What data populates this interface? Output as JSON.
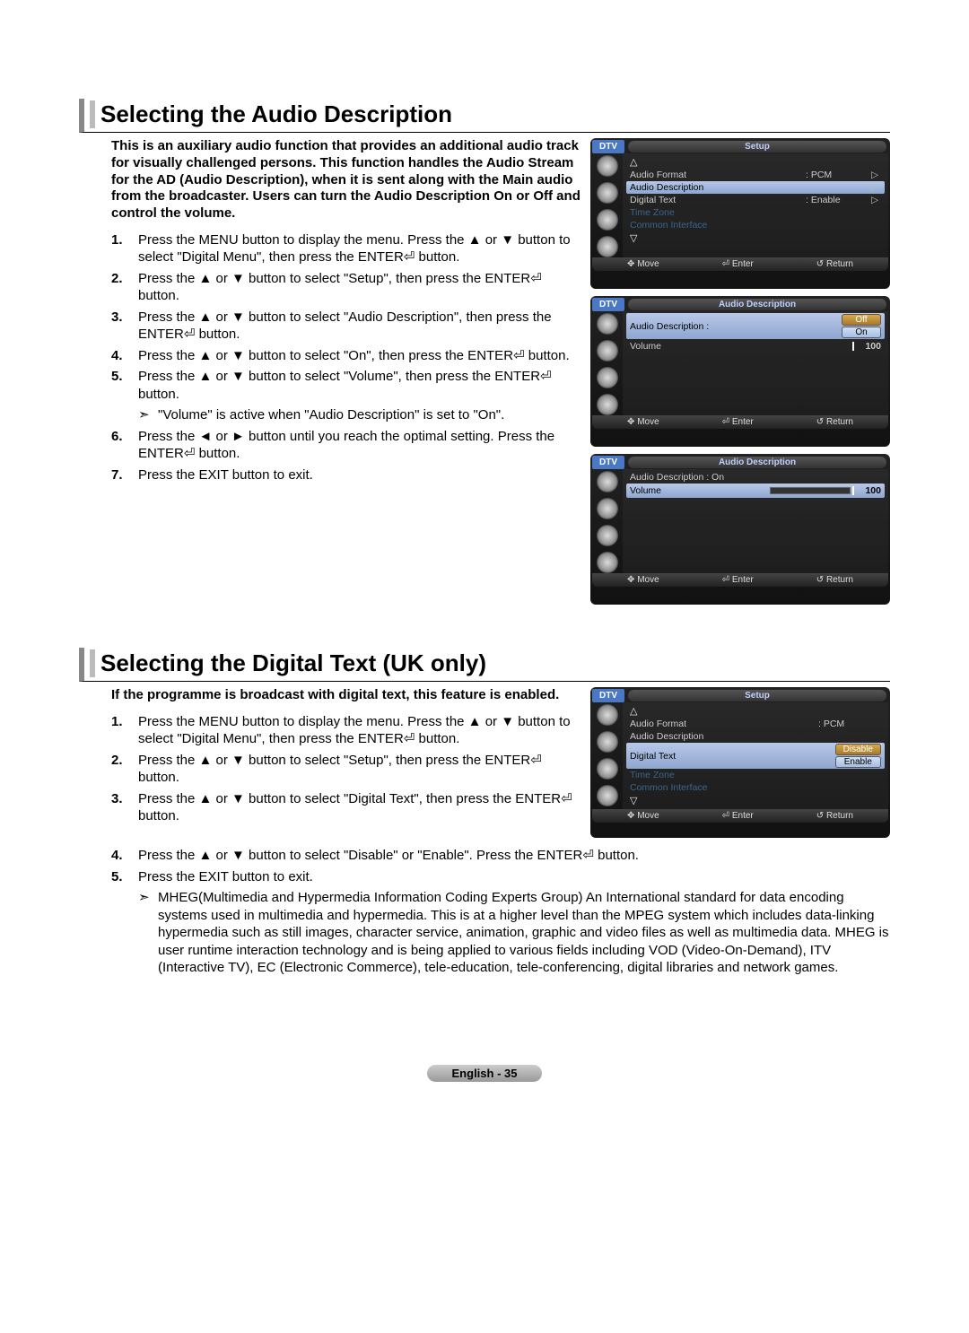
{
  "section1": {
    "title": "Selecting the Audio Description",
    "intro": "This is an auxiliary audio function that provides an additional audio track for visually challenged persons. This function handles the Audio Stream for the AD (Audio Description), when it is sent along with the Main audio from the broadcaster. Users can turn the Audio Description On or Off and control the volume.",
    "steps": [
      {
        "num": "1.",
        "text": "Press the MENU button to display the menu. Press the ▲ or ▼ button to select \"Digital Menu\", then press the ENTER⏎ button."
      },
      {
        "num": "2.",
        "text": "Press the ▲ or ▼ button to select \"Setup\", then press the ENTER⏎ button."
      },
      {
        "num": "3.",
        "text": "Press the ▲ or ▼ button to select \"Audio Description\", then press the ENTER⏎ button."
      },
      {
        "num": "4.",
        "text": "Press the ▲ or ▼ button to select \"On\", then press the ENTER⏎ button."
      },
      {
        "num": "5.",
        "text": "Press the ▲ or ▼ button to select \"Volume\", then press the ENTER⏎ button."
      },
      {
        "note": true,
        "text": "\"Volume\" is active when \"Audio Description\" is set to \"On\"."
      },
      {
        "num": "6.",
        "text": "Press the ◄ or ► button until you reach the optimal setting. Press the ENTER⏎ button."
      },
      {
        "num": "7.",
        "text": "Press the EXIT button to exit."
      }
    ],
    "screens": {
      "s1": {
        "dtv": "DTV",
        "title": "Setup",
        "rows": {
          "up": "△",
          "r1_label": "Audio Format",
          "r1_val": ": PCM",
          "r1_arr": "▷",
          "r2_label": "Audio Description",
          "r2_arr": "▷",
          "r3_label": "Digital Text",
          "r3_val": ": Enable",
          "r3_arr": "▷",
          "r4_label": "Time Zone",
          "r5_label": "Common Interface",
          "down": "▽"
        }
      },
      "s2": {
        "dtv": "DTV",
        "title": "Audio Description",
        "ad_label": "Audio Description :",
        "opt_off": "Off",
        "opt_on": "On",
        "vol_label": "Volume",
        "vol_val": "100"
      },
      "s3": {
        "dtv": "DTV",
        "title": "Audio Description",
        "ad_label": "Audio Description : On",
        "vol_label": "Volume",
        "vol_val": "100"
      },
      "footer": {
        "move": "Move",
        "enter": "Enter",
        "return": "Return"
      }
    }
  },
  "section2": {
    "title": "Selecting the Digital Text (UK only)",
    "intro": "If the programme is broadcast with digital text, this feature is enabled.",
    "steps": [
      {
        "num": "1.",
        "text": "Press the MENU button to display the menu. Press the ▲ or ▼ button to select \"Digital Menu\", then press the ENTER⏎ button."
      },
      {
        "num": "2.",
        "text": "Press the ▲ or ▼ button to select \"Setup\", then press the ENTER⏎ button."
      },
      {
        "num": "3.",
        "text": "Press the ▲ or ▼ button to select \"Digital Text\", then press the ENTER⏎ button."
      },
      {
        "num": "4.",
        "text": "Press the ▲ or ▼ button to select \"Disable\" or \"Enable\". Press the ENTER⏎ button."
      },
      {
        "num": "5.",
        "text": "Press the EXIT button to exit."
      },
      {
        "note": true,
        "text": "MHEG(Multimedia and Hypermedia Information Coding Experts Group) An International standard for data encoding systems used in multimedia and hypermedia. This is at a higher level than the MPEG system which includes data-linking hypermedia such as still images, character service, animation, graphic and video files as well as multimedia data. MHEG is user runtime interaction technology and is being applied to various fields including VOD (Video-On-Demand), ITV (Interactive TV), EC (Electronic Commerce), tele-education, tele-conferencing, digital libraries and network games."
      }
    ],
    "screen": {
      "dtv": "DTV",
      "title": "Setup",
      "rows": {
        "up": "△",
        "r1_label": "Audio Format",
        "r1_val": ": PCM",
        "r2_label": "Audio Description",
        "r3_label": "Digital Text",
        "opt_disable": "Disable",
        "opt_enable": "Enable",
        "r4_label": "Time Zone",
        "r5_label": "Common Interface",
        "down": "▽"
      }
    }
  },
  "glyphs": {
    "move": "✥",
    "enter": "⏎",
    "return": "↺",
    "note": "➣"
  },
  "footer": "English - 35"
}
